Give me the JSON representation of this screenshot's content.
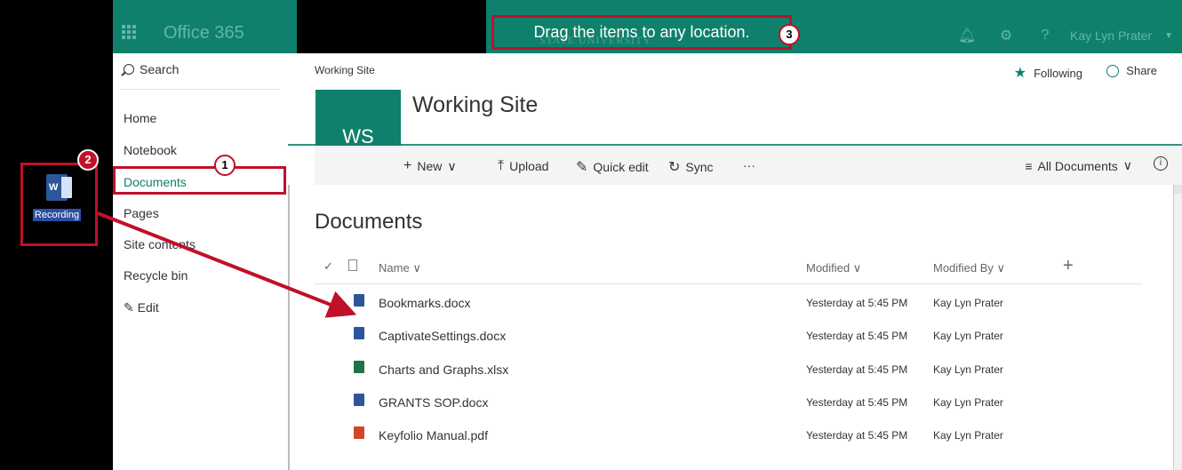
{
  "desktop": {
    "icon_label": "Recording",
    "icon_name": "word-document-icon"
  },
  "suite": {
    "brand": "Office 365",
    "watermark": "STATE UNIVERSITY",
    "user_name": "Kay Lyn Prater",
    "accent": "#0f806b",
    "icons": [
      "bell-icon",
      "gear-icon",
      "help-icon"
    ]
  },
  "callout": {
    "text": "Drag the items to any location.",
    "color": "#c0102a",
    "badges": [
      "1",
      "2",
      "3"
    ]
  },
  "leftnav": {
    "search_label": "Search",
    "items": [
      "Home",
      "Notebook",
      "Documents",
      "Pages",
      "Site contents",
      "Recycle bin"
    ],
    "edit_label": "Edit"
  },
  "header": {
    "breadcrumb": "Working Site",
    "following_label": "Following",
    "share_label": "Share",
    "site_logo": "WS",
    "site_title": "Working Site"
  },
  "commands": {
    "new_label": "New",
    "upload_label": "Upload",
    "quick_edit_label": "Quick edit",
    "sync_label": "Sync",
    "more_label": "···",
    "view_label": "All Documents"
  },
  "library": {
    "title": "Documents",
    "columns": {
      "name": "Name",
      "modified": "Modified",
      "modified_by": "Modified By"
    },
    "rows": [
      {
        "name": "Bookmarks.docx",
        "type": "word",
        "modified": "Yesterday at 5:45 PM",
        "modified_by": "Kay Lyn Prater"
      },
      {
        "name": "CaptivateSettings.docx",
        "type": "word",
        "modified": "Yesterday at 5:45 PM",
        "modified_by": "Kay Lyn Prater"
      },
      {
        "name": "Charts and Graphs.xlsx",
        "type": "excel",
        "modified": "Yesterday at 5:45 PM",
        "modified_by": "Kay Lyn Prater"
      },
      {
        "name": "GRANTS SOP.docx",
        "type": "word",
        "modified": "Yesterday at 5:45 PM",
        "modified_by": "Kay Lyn Prater"
      },
      {
        "name": "Keyfolio Manual.pdf",
        "type": "pdf",
        "modified": "Yesterday at 5:45 PM",
        "modified_by": "Kay Lyn Prater"
      }
    ]
  }
}
